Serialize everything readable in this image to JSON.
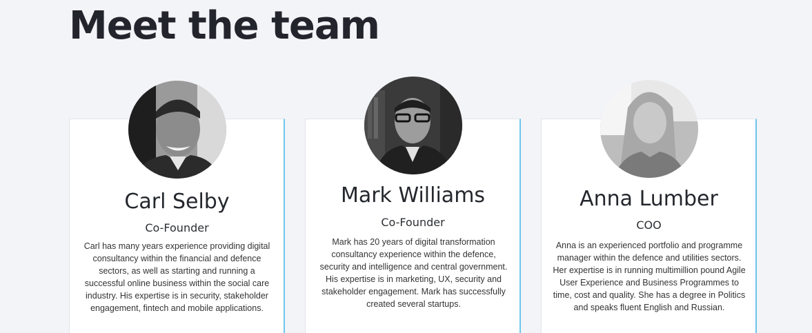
{
  "section": {
    "title": "Meet the team"
  },
  "members": [
    {
      "name": "Carl Selby",
      "role": "Co-Founder",
      "bio": "Carl has many years experience providing digital consultancy within the financial and defence sectors, as well as starting and running a successful online business within the social care industry. His expertise is in security, stakeholder engagement, fintech and mobile applications."
    },
    {
      "name": "Mark Williams",
      "role": "Co-Founder",
      "bio": "Mark has 20 years of digital transformation consultancy experience within the defence, security and intelligence and central government. His expertise is in marketing, UX, security and stakeholder engagement. Mark has successfully created several startups."
    },
    {
      "name": "Anna Lumber",
      "role": "COO",
      "bio": "Anna is an experienced portfolio and programme manager within the defence and utilities sectors. Her expertise is in running multimillion pound Agile User Experience and Business Programmes to time, cost and quality. She has a degree in Politics and speaks fluent English and Russian."
    }
  ],
  "colors": {
    "background": "#f3f4f8",
    "card": "#ffffff",
    "card_accent": "#6cc6ec",
    "heading": "#22252c"
  }
}
